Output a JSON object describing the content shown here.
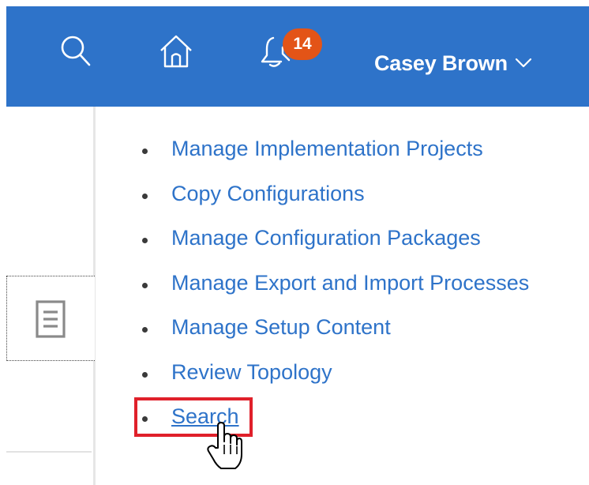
{
  "header": {
    "background_color": "#2e73c9",
    "icons": {
      "search": "search-icon",
      "home": "home-icon",
      "notifications": "notifications-icon"
    },
    "notification_badge": "14",
    "badge_color": "#e35417",
    "user_name": "Casey Brown",
    "user_menu_icon": "chevron-down-icon"
  },
  "side_panel": {
    "tile_icon": "document-icon"
  },
  "tasks": {
    "items": [
      {
        "label": "Manage Implementation Projects"
      },
      {
        "label": "Copy Configurations"
      },
      {
        "label": "Manage Configuration Packages"
      },
      {
        "label": "Manage Export and Import Processes"
      },
      {
        "label": "Manage Setup Content"
      },
      {
        "label": "Review Topology"
      },
      {
        "label": "Search",
        "highlighted": true,
        "hovered": true
      }
    ],
    "link_color": "#2e73c9",
    "highlight_color": "#e0202a"
  },
  "cursor": "pointer-hand-cursor"
}
